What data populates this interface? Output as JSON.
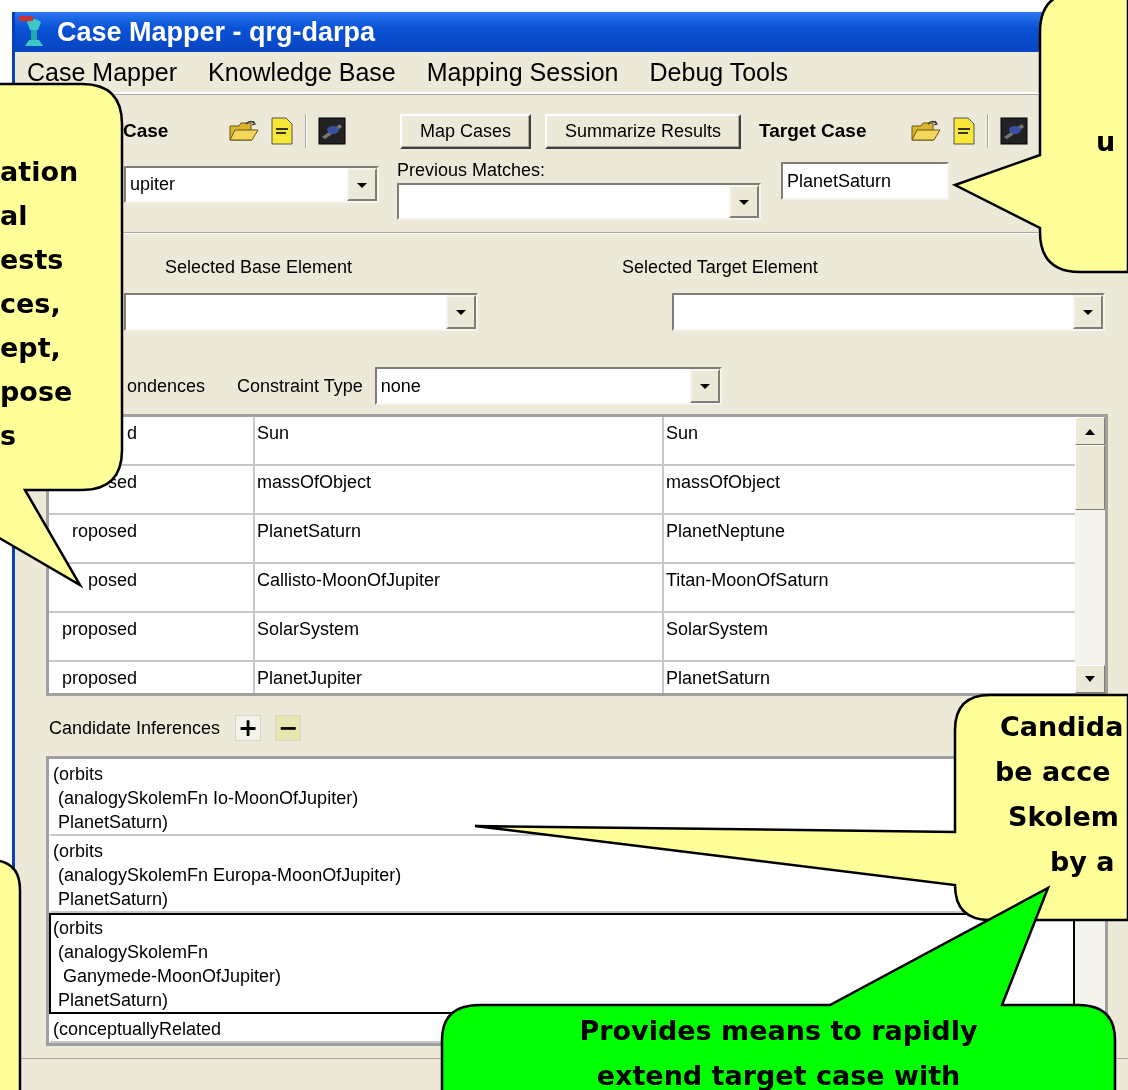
{
  "window": {
    "title": "Case Mapper - qrg-darpa"
  },
  "menu": [
    {
      "label": "Case Mapper"
    },
    {
      "label": "Knowledge Base"
    },
    {
      "label": "Mapping Session"
    },
    {
      "label": "Debug Tools"
    }
  ],
  "base_case": {
    "label": "Case",
    "value": "upiter"
  },
  "buttons": [
    {
      "label": "Map Cases"
    },
    {
      "label": "Summarize Results"
    }
  ],
  "previous_matches": {
    "label": "Previous Matches:"
  },
  "target_case": {
    "label": "Target Case",
    "value": "PlanetSaturn"
  },
  "selected_base_element": {
    "label": "Selected Base Element"
  },
  "selected_target_element": {
    "label": "Selected Target Element"
  },
  "correspondences": {
    "label": "ondences",
    "constraint_label": "Constraint Type",
    "constraint_value": "none"
  },
  "table": {
    "rows": [
      [
        "d",
        "Sun",
        "Sun"
      ],
      [
        "sed",
        "massOfObject",
        "massOfObject"
      ],
      [
        "roposed",
        "PlanetSaturn",
        "PlanetNeptune"
      ],
      [
        "posed",
        "Callisto-MoonOfJupiter",
        "Titan-MoonOfSaturn"
      ],
      [
        "proposed",
        "SolarSystem",
        "SolarSystem"
      ],
      [
        "proposed",
        "PlanetJupiter",
        "PlanetSaturn"
      ]
    ]
  },
  "candidate_inferences": {
    "label": "Candidate Inferences",
    "add": "+",
    "remove": "−",
    "items": [
      {
        "text": "(orbits\n (analogySkolemFn Io-MoonOfJupiter)\n PlanetSaturn)",
        "selected": false
      },
      {
        "text": "(orbits\n (analogySkolemFn Europa-MoonOfJupiter)\n PlanetSaturn)",
        "selected": false
      },
      {
        "text": "(orbits\n (analogySkolemFn\n  Ganymede-MoonOfJupiter)\n PlanetSaturn)",
        "selected": true
      },
      {
        "text": "(conceptuallyRelated",
        "selected": false
      }
    ]
  },
  "callouts": [
    {
      "color": "#ffff99",
      "lines": [
        "ation",
        "al",
        "ests",
        "ces,",
        "ept,",
        "pose",
        "s"
      ]
    },
    {
      "color": "#ffff99",
      "lines": [
        "u"
      ]
    },
    {
      "color": "#ffff99",
      "lines": [
        "Candida",
        "be acce",
        "Skolem",
        "by a"
      ]
    },
    {
      "color": "#00ff00",
      "lines": [
        "Provides means to rapidly",
        "extend target case with"
      ]
    },
    {
      "color": "#ffff99"
    }
  ]
}
